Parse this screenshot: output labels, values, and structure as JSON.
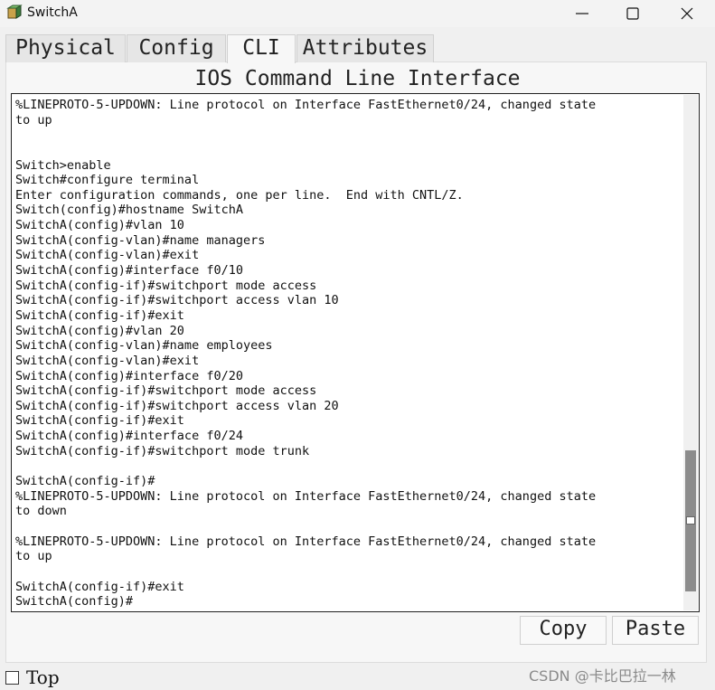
{
  "window": {
    "title": "SwitchA",
    "icon": "switch-app-icon",
    "controls": [
      "minimize-icon",
      "maximize-icon",
      "close-icon"
    ]
  },
  "tabs": [
    {
      "label": "Physical",
      "active": false
    },
    {
      "label": "Config",
      "active": false
    },
    {
      "label": "CLI",
      "active": true
    },
    {
      "label": "Attributes",
      "active": false
    }
  ],
  "panel": {
    "title": "IOS Command Line Interface"
  },
  "terminal": {
    "lines": [
      "%LINEPROTO-5-UPDOWN: Line protocol on Interface FastEthernet0/24, changed state",
      "to up",
      "",
      "",
      "Switch>enable",
      "Switch#configure terminal",
      "Enter configuration commands, one per line.  End with CNTL/Z.",
      "Switch(config)#hostname SwitchA",
      "SwitchA(config)#vlan 10",
      "SwitchA(config-vlan)#name managers",
      "SwitchA(config-vlan)#exit",
      "SwitchA(config)#interface f0/10",
      "SwitchA(config-if)#switchport mode access",
      "SwitchA(config-if)#switchport access vlan 10",
      "SwitchA(config-if)#exit",
      "SwitchA(config)#vlan 20",
      "SwitchA(config-vlan)#name employees",
      "SwitchA(config-vlan)#exit",
      "SwitchA(config)#interface f0/20",
      "SwitchA(config-if)#switchport mode access",
      "SwitchA(config-if)#switchport access vlan 20",
      "SwitchA(config-if)#exit",
      "SwitchA(config)#interface f0/24",
      "SwitchA(config-if)#switchport mode trunk",
      "",
      "SwitchA(config-if)#",
      "%LINEPROTO-5-UPDOWN: Line protocol on Interface FastEthernet0/24, changed state",
      "to down",
      "",
      "%LINEPROTO-5-UPDOWN: Line protocol on Interface FastEthernet0/24, changed state",
      "to up",
      "",
      "SwitchA(config-if)#exit",
      "SwitchA(config)#"
    ]
  },
  "buttons": {
    "copy": "Copy",
    "paste": "Paste"
  },
  "top_checkbox": {
    "label": "Top",
    "checked": false
  },
  "watermark": "CSDN @卡比巴拉一林"
}
